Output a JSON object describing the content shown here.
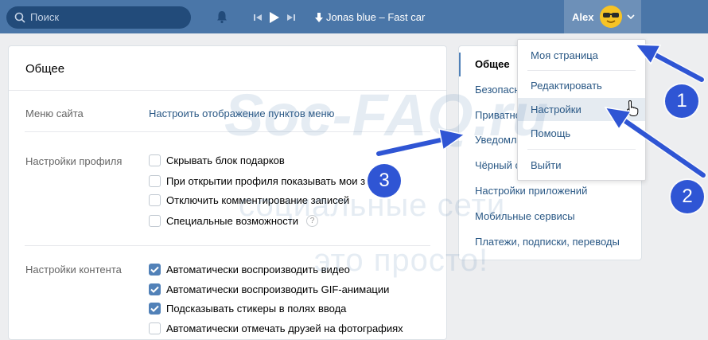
{
  "header": {
    "search_placeholder": "Поиск",
    "track": "Jonas blue – Fast car",
    "username": "Alex"
  },
  "main": {
    "title": "Общее",
    "menu_label": "Меню сайта",
    "menu_link": "Настроить отображение пунктов меню",
    "profile_label": "Настройки профиля",
    "profile_options": [
      {
        "label": "Скрывать блок подарков",
        "checked": false
      },
      {
        "label": "При открытии профиля показывать мои з",
        "checked": false
      },
      {
        "label": "Отключить комментирование записей",
        "checked": false
      },
      {
        "label": "Специальные возможности",
        "checked": false
      }
    ],
    "help_mark": "?",
    "content_label": "Настройки контента",
    "content_options": [
      {
        "label": "Автоматически воспроизводить видео",
        "checked": true
      },
      {
        "label": "Автоматически воспроизводить GIF-анимации",
        "checked": true
      },
      {
        "label": "Подсказывать стикеры в полях ввода",
        "checked": true
      },
      {
        "label": "Автоматически отмечать друзей на фотографиях",
        "checked": false
      }
    ]
  },
  "side_menu": {
    "items": [
      "Общее",
      "Безопасность",
      "Приватность",
      "Уведомления",
      "Чёрный список",
      "Настройки приложений",
      "Мобильные сервисы",
      "Платежи, подписки, переводы"
    ],
    "active_index": 0
  },
  "dropdown": {
    "items": [
      "Моя страница",
      "Редактировать",
      "Настройки",
      "Помощь",
      "Выйти"
    ],
    "hovered": "Настройки"
  },
  "watermark": {
    "brand": "Soc-FAQ.ru",
    "line1": "социальные сети",
    "line2": "это просто!"
  },
  "annotations": [
    "1",
    "2",
    "3"
  ],
  "colors": {
    "header": "#4a76a8",
    "link": "#2a5885",
    "accent": "#5181b8",
    "annotation": "#2f55d4",
    "page_bg": "#edeef0"
  }
}
